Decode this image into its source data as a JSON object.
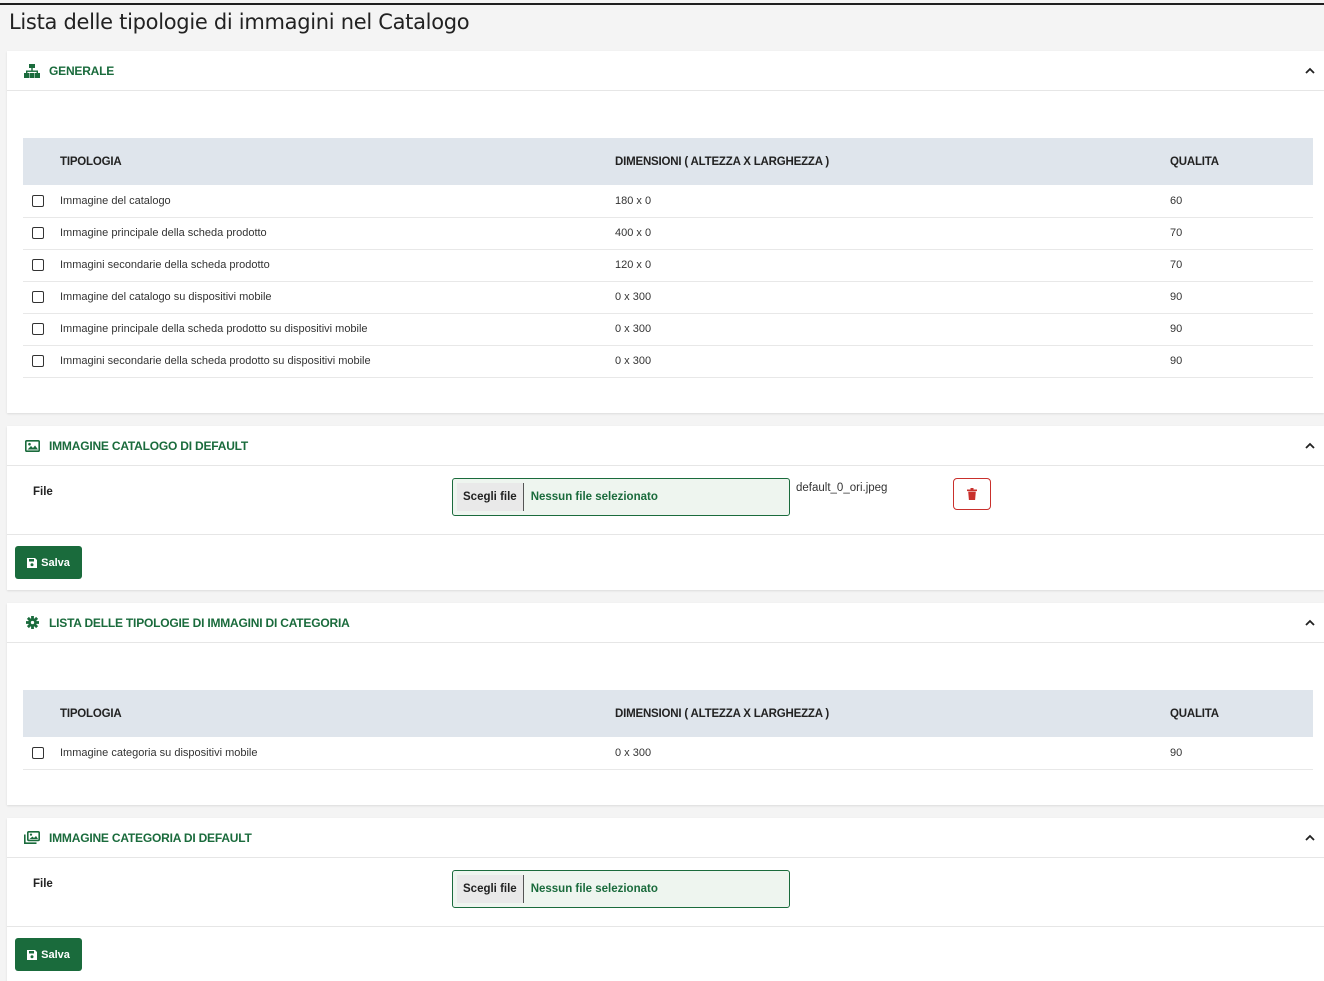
{
  "page": {
    "title": "Lista delle tipologie di immagini nel Catalogo"
  },
  "colors": {
    "accent": "#1a6b3c",
    "danger": "#c9302c",
    "table_header": "#dfe5ec"
  },
  "generale": {
    "title": "GENERALE",
    "icon": "sitemap-icon",
    "columns": [
      "TIPOLOGIA",
      "DIMENSIONI ( ALTEZZA X LARGHEZZA )",
      "QUALITA"
    ],
    "rows": [
      {
        "tipologia": "Immagine del catalogo",
        "dimensioni": "180 x 0",
        "qualita": "60"
      },
      {
        "tipologia": "Immagine principale della scheda prodotto",
        "dimensioni": "400 x 0",
        "qualita": "70"
      },
      {
        "tipologia": "Immagini secondarie della scheda prodotto",
        "dimensioni": "120 x 0",
        "qualita": "70"
      },
      {
        "tipologia": "Immagine del catalogo su dispositivi mobile",
        "dimensioni": "0 x 300",
        "qualita": "90"
      },
      {
        "tipologia": "Immagine principale della scheda prodotto su dispositivi mobile",
        "dimensioni": "0 x 300",
        "qualita": "90"
      },
      {
        "tipologia": "Immagini secondarie della scheda prodotto su dispositivi mobile",
        "dimensioni": "0 x 300",
        "qualita": "90"
      }
    ]
  },
  "catalog_default": {
    "title": "IMMAGINE CATALOGO DI DEFAULT",
    "icon": "image-icon",
    "file_label": "File",
    "choose_label": "Scegli file",
    "no_file": "Nessun file selezionato",
    "current_file": "default_0_ori.jpeg",
    "save_label": "Salva"
  },
  "categoria": {
    "title": "LISTA DELLE TIPOLOGIE DI IMMAGINI DI CATEGORIA",
    "icon": "gear-icon",
    "columns": [
      "TIPOLOGIA",
      "DIMENSIONI ( ALTEZZA X LARGHEZZA )",
      "QUALITA"
    ],
    "rows": [
      {
        "tipologia": "Immagine categoria su dispositivi mobile",
        "dimensioni": "0 x 300",
        "qualita": "90"
      }
    ]
  },
  "category_default": {
    "title": "IMMAGINE CATEGORIA DI DEFAULT",
    "icon": "images-icon",
    "file_label": "File",
    "choose_label": "Scegli file",
    "no_file": "Nessun file selezionato",
    "save_label": "Salva"
  }
}
